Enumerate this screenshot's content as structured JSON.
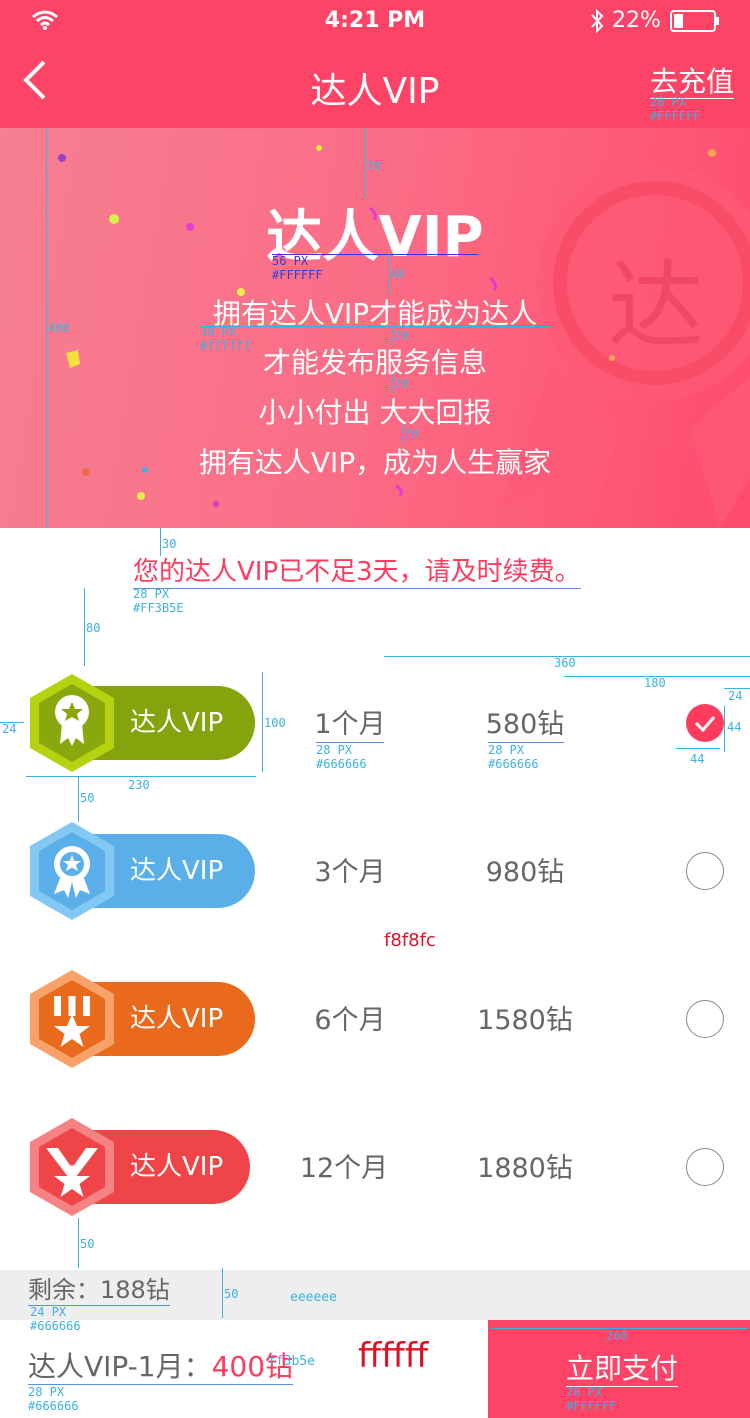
{
  "status": {
    "time": "4:21 PM",
    "battery": "22%"
  },
  "nav": {
    "title": "达人VIP",
    "right_action": "去充值",
    "back_icon": "chevron-left-icon"
  },
  "banner": {
    "title": "达人VIP",
    "lines": [
      "拥有达人VIP才能成为达人",
      "才能发布服务信息",
      "小小付出 大大回报",
      "拥有达人VIP，成为人生赢家"
    ],
    "badge_char": "达"
  },
  "notice": "您的达人VIP已不足3天，请及时续费。",
  "plans": [
    {
      "label": "达人VIP",
      "duration": "1个月",
      "price": "580钻",
      "color": "#86a20d",
      "selected": true,
      "icon": "rosette-star-icon"
    },
    {
      "label": "达人VIP",
      "duration": "3个月",
      "price": "980钻",
      "color": "#5aafe8",
      "selected": false,
      "icon": "rosette-star-icon"
    },
    {
      "label": "达人VIP",
      "duration": "6个月",
      "price": "1580钻",
      "color": "#ea6a1d",
      "selected": false,
      "icon": "medal-star-icon"
    },
    {
      "label": "达人VIP",
      "duration": "12个月",
      "price": "1880钻",
      "color": "#ef4548",
      "selected": false,
      "icon": "crown-star-icon"
    }
  ],
  "footer": {
    "remaining": "剩余：188钻",
    "selected_prefix": "达人VIP-1月：",
    "selected_price": "400钻",
    "pay_label": "立即支付"
  },
  "annotations": {
    "nav_right": [
      "28 PX",
      "#FFFFFF"
    ],
    "banner_title": [
      "56 PX",
      "#FFFFFF"
    ],
    "banner_lines": [
      "30 PX",
      "#ffffff"
    ],
    "notice": [
      "28 PX",
      "#FF3B5E"
    ],
    "plan_text": [
      "28 PX",
      "#666666"
    ],
    "remaining": [
      "24 PX",
      "#666666"
    ],
    "selected": [
      "28 PX",
      "#666666"
    ],
    "pay": [
      "28 PX",
      "#FFFFFF"
    ],
    "bg_plans": "f8f8fc",
    "bg_remaining": "eeeeee",
    "bg_footer": "ffffff",
    "price_color": "ff3b5e",
    "dims": {
      "banner_top": "70",
      "title_gap": "40",
      "line_gap": "20",
      "banner_h": "400",
      "notice_gap": "30",
      "rows_gap": "80",
      "right_w": "360",
      "right_half": "180",
      "right_margin": "24",
      "check": "44",
      "row_h": "100",
      "left_margin": "24",
      "pill_w": "230",
      "row_gap": "50",
      "bottom_gap": "50",
      "remain_h": "50",
      "pay_w": "260"
    }
  }
}
